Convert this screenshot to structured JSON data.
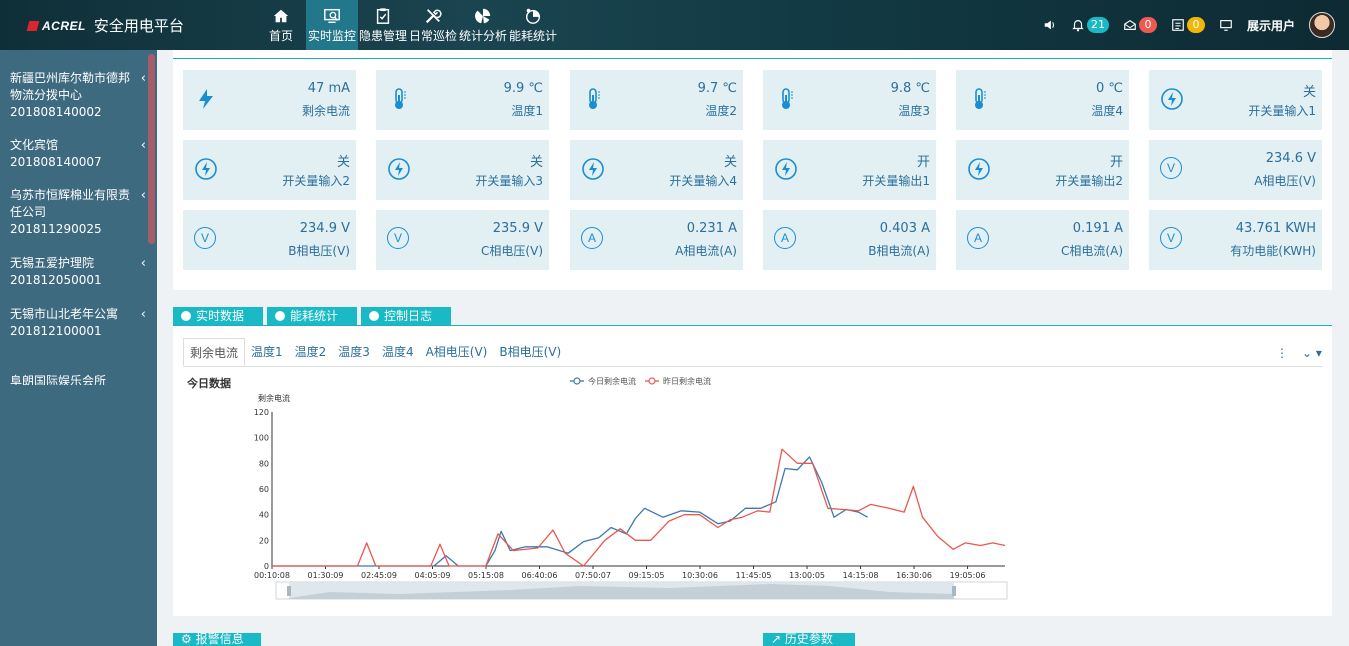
{
  "header": {
    "logo_text": "ACREL",
    "app_title": "安全用电平台",
    "nav": [
      {
        "label": "首页",
        "icon": "home-icon"
      },
      {
        "label": "实时监控",
        "icon": "monitor-icon",
        "active": true
      },
      {
        "label": "隐患管理",
        "icon": "clipboard-icon"
      },
      {
        "label": "日常巡检",
        "icon": "tools-icon"
      },
      {
        "label": "统计分析",
        "icon": "chart-icon"
      },
      {
        "label": "能耗统计",
        "icon": "energy-icon"
      }
    ],
    "notifications": {
      "alarm_count": "21",
      "mail_count": "0",
      "task_count": "0"
    },
    "user_name": "展示用户",
    "colors": {
      "teal_badge": "#19b9c6",
      "red_badge": "#ee5a52",
      "yellow_badge": "#f2b705"
    }
  },
  "sidebar": {
    "sites": [
      {
        "name": "新疆巴州库尔勒市德邦物流分拨中心",
        "id": "201808140002"
      },
      {
        "name": "文化宾馆",
        "id": "201808140007"
      },
      {
        "name": "乌苏市恒辉棉业有限责任公司",
        "id": "201811290025"
      },
      {
        "name": "无锡五爱护理院",
        "id": "201812050001"
      },
      {
        "name": "无锡市山北老年公寓",
        "id": "201812100001"
      },
      {
        "name": "阜朗国际娱乐会所",
        "id": ""
      }
    ]
  },
  "tiles": [
    {
      "value": "47 mA",
      "label": "剩余电流",
      "icon": "bolt-icon"
    },
    {
      "value": "9.9 ℃",
      "label": "温度1",
      "icon": "thermometer-icon"
    },
    {
      "value": "9.7 ℃",
      "label": "温度2",
      "icon": "thermometer-icon"
    },
    {
      "value": "9.8 ℃",
      "label": "温度3",
      "icon": "thermometer-icon"
    },
    {
      "value": "0 ℃",
      "label": "温度4",
      "icon": "thermometer-icon"
    },
    {
      "value": "关",
      "label": "开关量输入1",
      "icon": "switch-icon"
    },
    {
      "value": "关",
      "label": "开关量输入2",
      "icon": "switch-icon"
    },
    {
      "value": "关",
      "label": "开关量输入3",
      "icon": "switch-icon"
    },
    {
      "value": "关",
      "label": "开关量输入4",
      "icon": "switch-icon"
    },
    {
      "value": "开",
      "label": "开关量输出1",
      "icon": "switch-icon"
    },
    {
      "value": "开",
      "label": "开关量输出2",
      "icon": "switch-icon"
    },
    {
      "value": "234.6 V",
      "label": "A相电压(V)",
      "icon": "voltage-icon",
      "glyph": "V"
    },
    {
      "value": "234.9 V",
      "label": "B相电压(V)",
      "icon": "voltage-icon",
      "glyph": "V"
    },
    {
      "value": "235.9 V",
      "label": "C相电压(V)",
      "icon": "voltage-icon",
      "glyph": "V"
    },
    {
      "value": "0.231 A",
      "label": "A相电流(A)",
      "icon": "current-icon",
      "glyph": "A"
    },
    {
      "value": "0.403 A",
      "label": "B相电流(A)",
      "icon": "current-icon",
      "glyph": "A"
    },
    {
      "value": "0.191 A",
      "label": "C相电流(A)",
      "icon": "current-icon",
      "glyph": "A"
    },
    {
      "value": "43.761 KWH",
      "label": "有功电能(KWH)",
      "icon": "energy-icon",
      "glyph": "V"
    }
  ],
  "main_tabs": [
    "实时数据",
    "能耗统计",
    "控制日志"
  ],
  "sub_tabs": [
    "剩余电流",
    "温度1",
    "温度2",
    "温度3",
    "温度4",
    "A相电压(V)",
    "B相电压(V)"
  ],
  "today_label": "今日数据",
  "bottom_tabs": [
    "报警信息",
    "历史参数"
  ],
  "chart_data": {
    "type": "line",
    "ylabel": "剩余电流",
    "ylim": [
      0,
      120
    ],
    "yticks": [
      0,
      20,
      40,
      60,
      80,
      100,
      120
    ],
    "x_tick_labels": [
      "00:10:08",
      "01:30:09",
      "02:45:09",
      "04:05:09",
      "05:15:08",
      "06:40:06",
      "07:50:07",
      "09:15:05",
      "10:30:06",
      "11:45:05",
      "13:00:05",
      "14:15:08",
      "16:30:06",
      "19:05:06"
    ],
    "legend_position": "top-center",
    "series": [
      {
        "name": "今日剩余电流",
        "color": "#3b79b0",
        "points": [
          [
            0,
            0
          ],
          [
            3,
            0
          ],
          [
            4.5,
            0
          ],
          [
            5.3,
            0
          ],
          [
            5.7,
            8
          ],
          [
            6.1,
            0
          ],
          [
            7.0,
            0
          ],
          [
            7.3,
            12
          ],
          [
            7.5,
            27
          ],
          [
            7.8,
            12
          ],
          [
            8.3,
            15
          ],
          [
            9.0,
            15
          ],
          [
            9.7,
            10
          ],
          [
            10.2,
            19
          ],
          [
            10.7,
            22
          ],
          [
            11.1,
            30
          ],
          [
            11.6,
            25
          ],
          [
            11.9,
            37
          ],
          [
            12.2,
            45
          ],
          [
            12.8,
            38
          ],
          [
            13.4,
            43
          ],
          [
            14.0,
            42
          ],
          [
            14.6,
            33
          ],
          [
            15.0,
            35
          ],
          [
            15.5,
            45
          ],
          [
            16.0,
            45
          ],
          [
            16.5,
            50
          ],
          [
            16.8,
            76
          ],
          [
            17.2,
            75
          ],
          [
            17.6,
            85
          ],
          [
            18.0,
            65
          ],
          [
            18.4,
            38
          ],
          [
            18.8,
            44
          ],
          [
            19.2,
            42
          ],
          [
            19.5,
            38
          ]
        ]
      },
      {
        "name": "昨日剩余电流",
        "color": "#e9584d",
        "points": [
          [
            0,
            0
          ],
          [
            2,
            0
          ],
          [
            2.8,
            0
          ],
          [
            3.1,
            18
          ],
          [
            3.4,
            0
          ],
          [
            5.2,
            0
          ],
          [
            5.5,
            17
          ],
          [
            5.8,
            0
          ],
          [
            7.0,
            0
          ],
          [
            7.4,
            25
          ],
          [
            7.9,
            12
          ],
          [
            8.7,
            14
          ],
          [
            9.2,
            28
          ],
          [
            9.6,
            10
          ],
          [
            10.2,
            0
          ],
          [
            10.9,
            20
          ],
          [
            11.4,
            29
          ],
          [
            11.9,
            20
          ],
          [
            12.4,
            20
          ],
          [
            13.0,
            35
          ],
          [
            13.5,
            40
          ],
          [
            14.0,
            40
          ],
          [
            14.6,
            30
          ],
          [
            15.0,
            36
          ],
          [
            15.4,
            38
          ],
          [
            15.9,
            43
          ],
          [
            16.3,
            42
          ],
          [
            16.7,
            91
          ],
          [
            17.2,
            80
          ],
          [
            17.7,
            80
          ],
          [
            18.2,
            45
          ],
          [
            18.7,
            44
          ],
          [
            19.2,
            43
          ],
          [
            19.6,
            48
          ],
          [
            20.2,
            45
          ],
          [
            20.7,
            42
          ],
          [
            21.0,
            62
          ],
          [
            21.3,
            38
          ],
          [
            21.8,
            23
          ],
          [
            22.3,
            13
          ],
          [
            22.7,
            18
          ],
          [
            23.2,
            16
          ],
          [
            23.6,
            18
          ],
          [
            24.0,
            16
          ]
        ]
      }
    ]
  }
}
